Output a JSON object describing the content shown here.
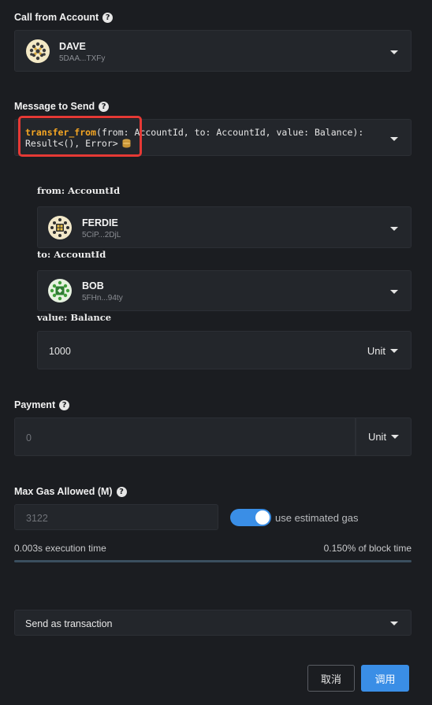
{
  "call_from": {
    "label": "Call from Account",
    "account": {
      "name": "DAVE",
      "address": "5DAA...TXFy"
    }
  },
  "message": {
    "label": "Message to Send",
    "method": "transfer_from",
    "signature_line1": "(from: AccountId, to: AccountId, value: Balance):",
    "signature_line2": "Result<(), Error>",
    "highlight_color": "#e53935",
    "method_color": "#f5a623"
  },
  "params": {
    "from": {
      "label": "from: AccountId",
      "name": "FERDIE",
      "address": "5CiP...2DjL"
    },
    "to": {
      "label": "to: AccountId",
      "name": "BOB",
      "address": "5FHn...94ty"
    },
    "value": {
      "label": "value: Balance",
      "amount": "1000",
      "unit": "Unit"
    }
  },
  "payment": {
    "label": "Payment",
    "placeholder": "0",
    "unit": "Unit"
  },
  "gas": {
    "label": "Max Gas Allowed (M)",
    "placeholder": "3122",
    "toggle_label": "use estimated gas",
    "toggle_on": true,
    "execution_time": "0.003s execution time",
    "block_time": "0.150% of block time"
  },
  "send_mode": {
    "value": "Send as transaction"
  },
  "actions": {
    "cancel": "取消",
    "call": "调用"
  },
  "colors": {
    "accent": "#3a8ee6",
    "background": "#1b1d21",
    "field": "#23262b"
  }
}
